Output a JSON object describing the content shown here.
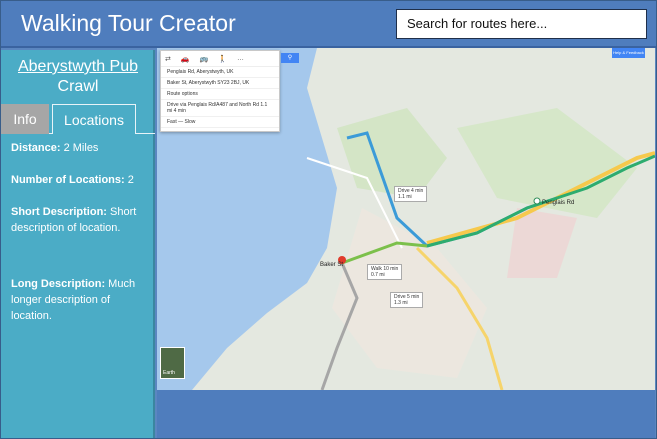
{
  "header": {
    "title": "Walking Tour Creator",
    "search_placeholder": "Search for routes here..."
  },
  "sidebar": {
    "route_name_link": "Aberystwyth Pub",
    "route_name_rest": "Crawl",
    "tabs": [
      "Info",
      "Locations"
    ],
    "details": {
      "distance_label": "Distance:",
      "distance_value": "2 Miles",
      "num_locations_label": "Number of Locations:",
      "num_locations_value": "2",
      "short_label": "Short Description:",
      "short_value": "Short description of location.",
      "long_label": "Long Description:",
      "long_value": "Much longer description of location."
    }
  },
  "map": {
    "directions": {
      "from": "Penglais Rd, Aberystwyth, UK",
      "to": "Baker St, Aberystwyth SY23 2BJ, UK",
      "route_options": "Route options",
      "summary": "Drive via Penglais Rd/A487 and North Rd   1.1 mi",
      "time": "4 min",
      "traffic_legend": "Fast — Slow"
    },
    "callouts": {
      "drive4": "Drive 4 min",
      "drive4_dist": "1.1 mi",
      "walk": "Walk 10 min",
      "walk_dist": "0.7 mi",
      "drive5": "Drive 5 min",
      "drive5_dist": "1.3 mi"
    },
    "labels": {
      "baker_st": "Baker St",
      "penglais_rd": "Penglais Rd",
      "earth": "Earth",
      "help": "Help & Feedback"
    }
  }
}
